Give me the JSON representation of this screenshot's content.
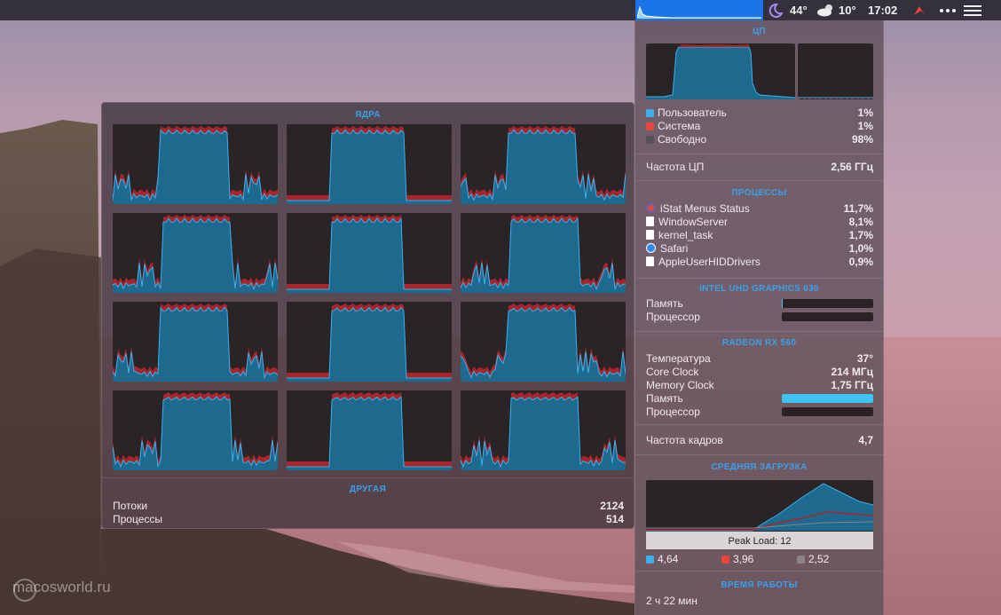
{
  "menubar": {
    "temp": "44°",
    "weather_temp": "10°",
    "time": "17:02",
    "icons": [
      "cpu-graph-icon",
      "moon-icon",
      "cloud-sun-icon",
      "red-app-icon",
      "more-icon",
      "list-icon"
    ]
  },
  "cores_panel": {
    "title": "ЯДРА",
    "other_title": "ДРУГАЯ",
    "threads_label": "Потоки",
    "threads_value": "2124",
    "processes_label": "Процессы",
    "processes_value": "514"
  },
  "cpu": {
    "title": "ЦП",
    "user_label": "Пользователь",
    "user_value": "1%",
    "system_label": "Система",
    "system_value": "1%",
    "free_label": "Свободно",
    "free_value": "98%",
    "freq_label": "Частота ЦП",
    "freq_value": "2,56 ГГц",
    "colors": {
      "user": "#3ab0f0",
      "system": "#e8463a",
      "free": "#555055"
    }
  },
  "processes": {
    "title": "ПРОЦЕССЫ",
    "items": [
      {
        "name": "iStat Menus Status",
        "value": "11,7%",
        "icon": "istat-icon"
      },
      {
        "name": "WindowServer",
        "value": "8,1%",
        "icon": "document-icon"
      },
      {
        "name": "kernel_task",
        "value": "1,7%",
        "icon": "document-icon"
      },
      {
        "name": "Safari",
        "value": "1,0%",
        "icon": "safari-icon"
      },
      {
        "name": "AppleUserHIDDrivers",
        "value": "0,9%",
        "icon": "document-icon"
      }
    ]
  },
  "intel_gpu": {
    "title": "INTEL UHD GRAPHICS 630",
    "memory_label": "Память",
    "memory_level": 0.01,
    "processor_label": "Процессор",
    "processor_level": 0.0
  },
  "radeon_gpu": {
    "title": "RADEON RX 560",
    "temp_label": "Температура",
    "temp_value": "37°",
    "core_label": "Core Clock",
    "core_value": "214 МГц",
    "mem_clock_label": "Memory Clock",
    "mem_clock_value": "1,75 ГГц",
    "memory_label": "Память",
    "memory_level": 1.0,
    "processor_label": "Процессор",
    "processor_level": 0.0,
    "fps_label": "Частота кадров",
    "fps_value": "4,7"
  },
  "load": {
    "title": "СРЕДНЯЯ ЗАГРУЗКА",
    "peak_label": "Peak Load: 12",
    "v1": "4,64",
    "v5": "3,96",
    "v15": "2,52",
    "colors": {
      "v1": "#3ab0f0",
      "v5": "#e8463a",
      "v15": "#8a8488"
    }
  },
  "uptime": {
    "title": "ВРЕМЯ РАБОТЫ",
    "value": "2 ч 22 мин"
  },
  "watermark": "macosworld.ru"
}
